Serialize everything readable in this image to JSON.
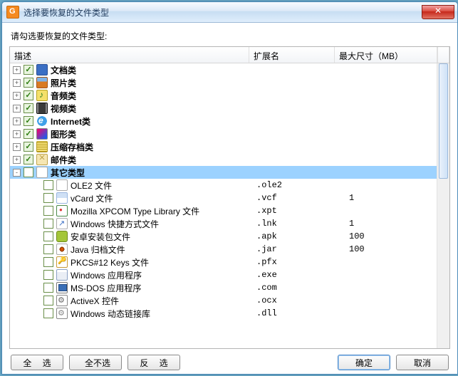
{
  "window": {
    "title": "选择要恢复的文件类型"
  },
  "prompt": "请勾选要恢复的文件类型:",
  "columns": {
    "desc": "描述",
    "ext": "扩展名",
    "size": "最大尺寸（MB）"
  },
  "categories": [
    {
      "label": "文档类",
      "icon": "doc",
      "checked": true,
      "expanded": false
    },
    {
      "label": "照片类",
      "icon": "photo",
      "checked": true,
      "expanded": false
    },
    {
      "label": "音频类",
      "icon": "audio",
      "checked": true,
      "expanded": false
    },
    {
      "label": "视频类",
      "icon": "video",
      "checked": true,
      "expanded": false
    },
    {
      "label": "Internet类",
      "icon": "ie",
      "checked": true,
      "expanded": false
    },
    {
      "label": "图形类",
      "icon": "gfx",
      "checked": true,
      "expanded": false
    },
    {
      "label": "压缩存档类",
      "icon": "zip",
      "checked": true,
      "expanded": false
    },
    {
      "label": "邮件类",
      "icon": "mail",
      "checked": true,
      "expanded": false
    },
    {
      "label": "其它类型",
      "icon": "file",
      "checked": false,
      "expanded": true,
      "selected": true
    }
  ],
  "children": [
    {
      "label": "OLE2 文件",
      "icon": "file",
      "ext": ".ole2",
      "size": ""
    },
    {
      "label": "vCard 文件",
      "icon": "vcf",
      "ext": ".vcf",
      "size": "1"
    },
    {
      "label": "Mozilla XPCOM Type Library 文件",
      "icon": "xpcom",
      "ext": ".xpt",
      "size": ""
    },
    {
      "label": "Windows 快捷方式文件",
      "icon": "lnk",
      "ext": ".lnk",
      "size": "1"
    },
    {
      "label": "安卓安装包文件",
      "icon": "apk",
      "ext": ".apk",
      "size": "100"
    },
    {
      "label": "Java 归档文件",
      "icon": "jar",
      "ext": ".jar",
      "size": "100"
    },
    {
      "label": "PKCS#12 Keys 文件",
      "icon": "pfx",
      "ext": ".pfx",
      "size": ""
    },
    {
      "label": "Windows 应用程序",
      "icon": "exe",
      "ext": ".exe",
      "size": ""
    },
    {
      "label": "MS-DOS 应用程序",
      "icon": "com",
      "ext": ".com",
      "size": ""
    },
    {
      "label": "ActiveX 控件",
      "icon": "ocx",
      "ext": ".ocx",
      "size": ""
    },
    {
      "label": "Windows 动态链接库",
      "icon": "dll",
      "ext": ".dll",
      "size": ""
    }
  ],
  "buttons": {
    "select_all": "全 选",
    "select_none": "全不选",
    "invert": "反  选",
    "ok": "确定",
    "cancel": "取消"
  }
}
